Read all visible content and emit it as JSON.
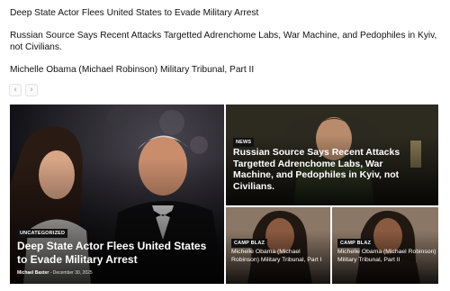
{
  "ticker": [
    "Deep State Actor Flees United States to Evade Military Arrest",
    "Russian Source Says Recent Attacks Targetted Adrenchome Labs, War Machine, and Pedophiles in Kyiv, not Civilians.",
    "Michelle Obama (Michael Robinson) Military Tribunal, Part II"
  ],
  "slider": {
    "prev_icon": "chevron-left-icon",
    "next_icon": "chevron-right-icon",
    "prev_glyph": "‹",
    "next_glyph": "›"
  },
  "featured": {
    "main": {
      "category": "UNCATEGORIZED",
      "title": "Deep State Actor Flees United States to Evade Military Arrest",
      "author": "Michael Baxter",
      "separator": "-",
      "date": "December 30, 2025"
    },
    "top_right": {
      "category": "NEWS",
      "title": "Russian Source Says Recent Attacks Targetted Adrenchome Labs, War Machine, and Pedophiles in Kyiv, not Civilians."
    },
    "bottom_left": {
      "category": "CAMP BLAZ",
      "title": "Michelle Obama (Michael Robinson) Military Tribunal, Part I"
    },
    "bottom_right": {
      "category": "CAMP BLAZ",
      "title": "Michelle Obama (Michael Robinson) Military Tribunal, Part II"
    }
  },
  "colors": {
    "category_bg": "#111111",
    "headline": "#ffffff",
    "page_bg": "#ffffff"
  }
}
